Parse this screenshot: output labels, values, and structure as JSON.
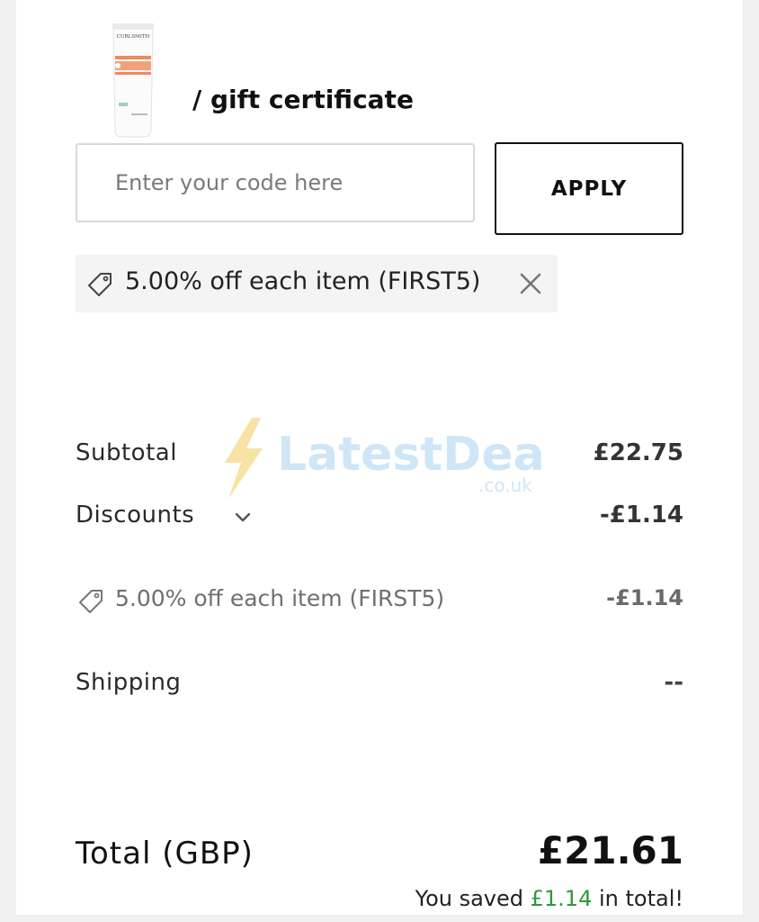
{
  "coupon": {
    "heading": "/ gift certificate",
    "input_placeholder": "Enter your code here",
    "apply_label": "APPLY",
    "applied_chip": "5.00% off each item (FIRST5)"
  },
  "summary": {
    "subtotal_label": "Subtotal",
    "subtotal_value": "£22.75",
    "discounts_label": "Discounts",
    "discounts_value": "-£1.14",
    "discount_line_label": "5.00% off each item (FIRST5)",
    "discount_line_value": "-£1.14",
    "shipping_label": "Shipping",
    "shipping_value": "--",
    "total_label": "Total (GBP)",
    "total_value": "£21.61",
    "saved_prefix": "You saved ",
    "saved_amount": "£1.14",
    "saved_suffix": " in total!"
  },
  "product": {
    "brand": "CURLSMITH"
  },
  "watermark": {
    "name": "LatestDeals",
    "domain": ".co.uk"
  },
  "colors": {
    "saved_amount": "#2e9a3a",
    "watermark_text": "#cfe6f6",
    "watermark_bolt": "#f7e3a6"
  },
  "icons": {
    "chip_tag": "tag-icon",
    "chip_remove": "close-icon",
    "discounts_toggle": "chevron-down-icon",
    "line_tag": "tag-icon"
  }
}
